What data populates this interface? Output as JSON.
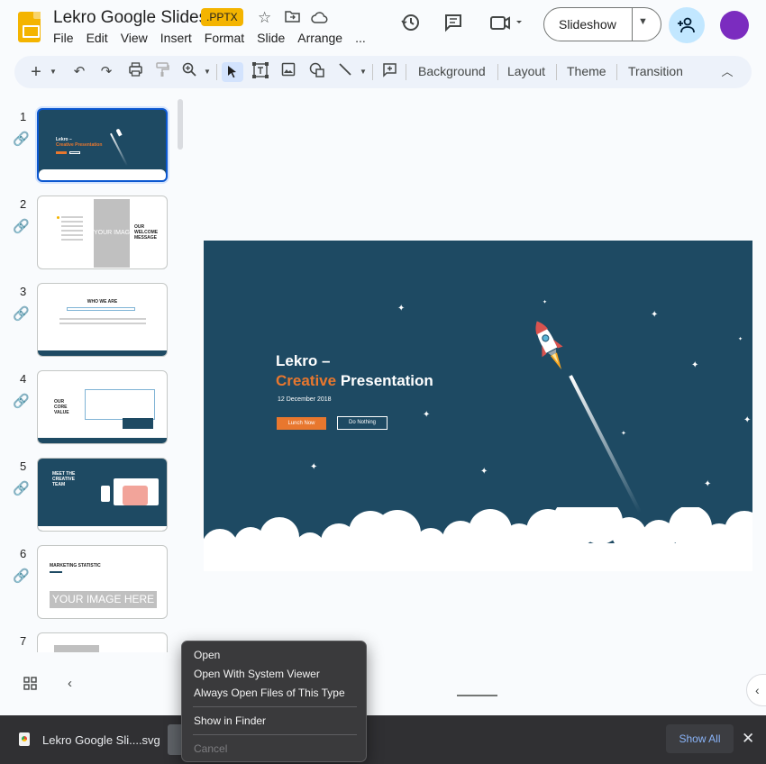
{
  "header": {
    "doc_title": "Lekro Google Slides",
    "file_badge": ".PPTX",
    "menus": [
      "File",
      "Edit",
      "View",
      "Insert",
      "Format",
      "Slide",
      "Arrange",
      "..."
    ],
    "slideshow_label": "Slideshow"
  },
  "toolbar": {
    "background_label": "Background",
    "layout_label": "Layout",
    "theme_label": "Theme",
    "transition_label": "Transition"
  },
  "filmstrip": {
    "slides": [
      {
        "number": "1",
        "title_line1": "Lekro –",
        "title_line2": "Creative Presentation"
      },
      {
        "number": "2",
        "heading": "OUR WELCOME MESSAGE",
        "image_placeholder": "YOUR IMAGE HERE"
      },
      {
        "number": "3",
        "heading": "WHO WE ARE"
      },
      {
        "number": "4",
        "heading": "OUR CORE VALUE"
      },
      {
        "number": "5",
        "heading": "MEET THE CREATIVE TEAM"
      },
      {
        "number": "6",
        "heading": "MARKETING STATISTIC",
        "image_placeholder": "YOUR IMAGE HERE"
      },
      {
        "number": "7"
      }
    ]
  },
  "main_slide": {
    "title_line1": "Lekro –",
    "title_accent": "Creative",
    "title_rest": " Presentation",
    "date": "12 December 2018",
    "primary_button": "Lunch Now",
    "secondary_button": "Do Nothing",
    "colors": {
      "background": "#1e4a63",
      "accent": "#e8772e"
    }
  },
  "download_bar": {
    "file_name": "Lekro Google Sli....svg",
    "show_all_label": "Show All"
  },
  "context_menu": {
    "items": [
      "Open",
      "Open With System Viewer",
      "Always Open Files of This Type",
      "Show in Finder",
      "Cancel"
    ]
  }
}
